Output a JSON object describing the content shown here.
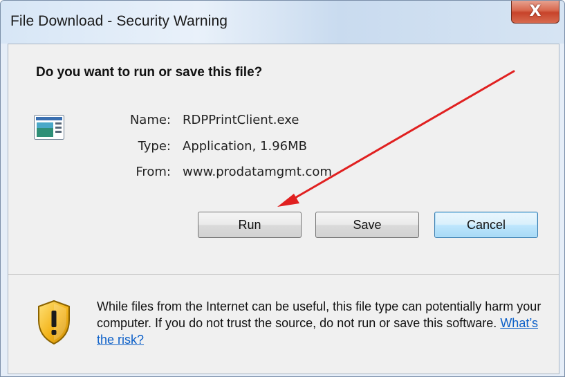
{
  "window": {
    "title": "File Download - Security Warning",
    "close_glyph": "X"
  },
  "dialog": {
    "question": "Do you want to run or save this file?",
    "file": {
      "icon": "application-icon",
      "name_label": "Name:",
      "name_value": "RDPPrintClient.exe",
      "type_label": "Type:",
      "type_value": "Application, 1.96MB",
      "from_label": "From:",
      "from_value": "www.prodatamgmt.com"
    },
    "buttons": {
      "run": "Run",
      "save": "Save",
      "cancel": "Cancel"
    },
    "warning": {
      "icon": "shield-warning-icon",
      "text": "While files from the Internet can be useful, this file type can potentially harm your computer. If you do not trust the source, do not run or save this software. ",
      "link": "What’s the risk?"
    }
  },
  "annotation": {
    "arrow_color": "#e02020"
  },
  "colors": {
    "link": "#0b5fc8",
    "default_button_border": "#3c7fb1",
    "close_button": "#c7432a"
  }
}
